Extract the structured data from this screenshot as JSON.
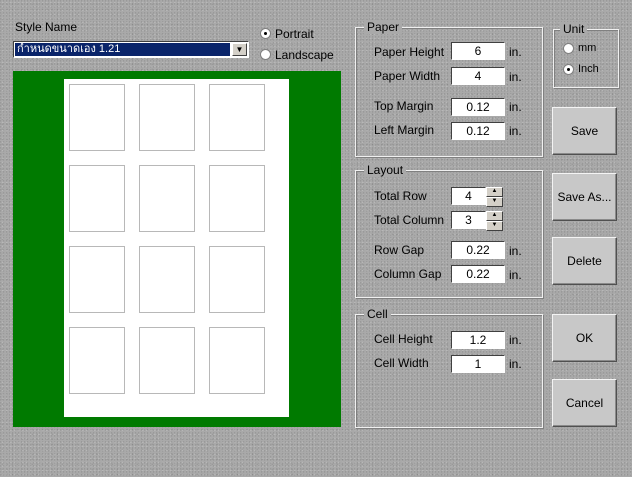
{
  "style": {
    "label": "Style Name",
    "selected": "กำหนดขนาดเอง 1.21"
  },
  "orientation": {
    "portrait": "Portrait",
    "landscape": "Landscape",
    "selected": "Portrait"
  },
  "paper": {
    "title": "Paper",
    "height_label": "Paper Height",
    "height": "6",
    "width_label": "Paper Width",
    "width": "4",
    "top_margin_label": "Top Margin",
    "top_margin": "0.12",
    "left_margin_label": "Left Margin",
    "left_margin": "0.12"
  },
  "layout": {
    "title": "Layout",
    "total_row_label": "Total Row",
    "total_row": "4",
    "total_column_label": "Total Column",
    "total_column": "3",
    "row_gap_label": "Row Gap",
    "row_gap": "0.22",
    "column_gap_label": "Column Gap",
    "column_gap": "0.22"
  },
  "cell": {
    "title": "Cell",
    "height_label": "Cell Height",
    "height": "1.2",
    "width_label": "Cell Width",
    "width": "1"
  },
  "unit": {
    "title": "Unit",
    "mm": "mm",
    "inch": "Inch",
    "selected": "Inch",
    "suffix": "in."
  },
  "buttons": {
    "save": "Save",
    "save_as": "Save As...",
    "delete": "Delete",
    "ok": "OK",
    "cancel": "Cancel"
  },
  "colors": {
    "preview_background": "#007a00",
    "selection": "#0a246a"
  }
}
